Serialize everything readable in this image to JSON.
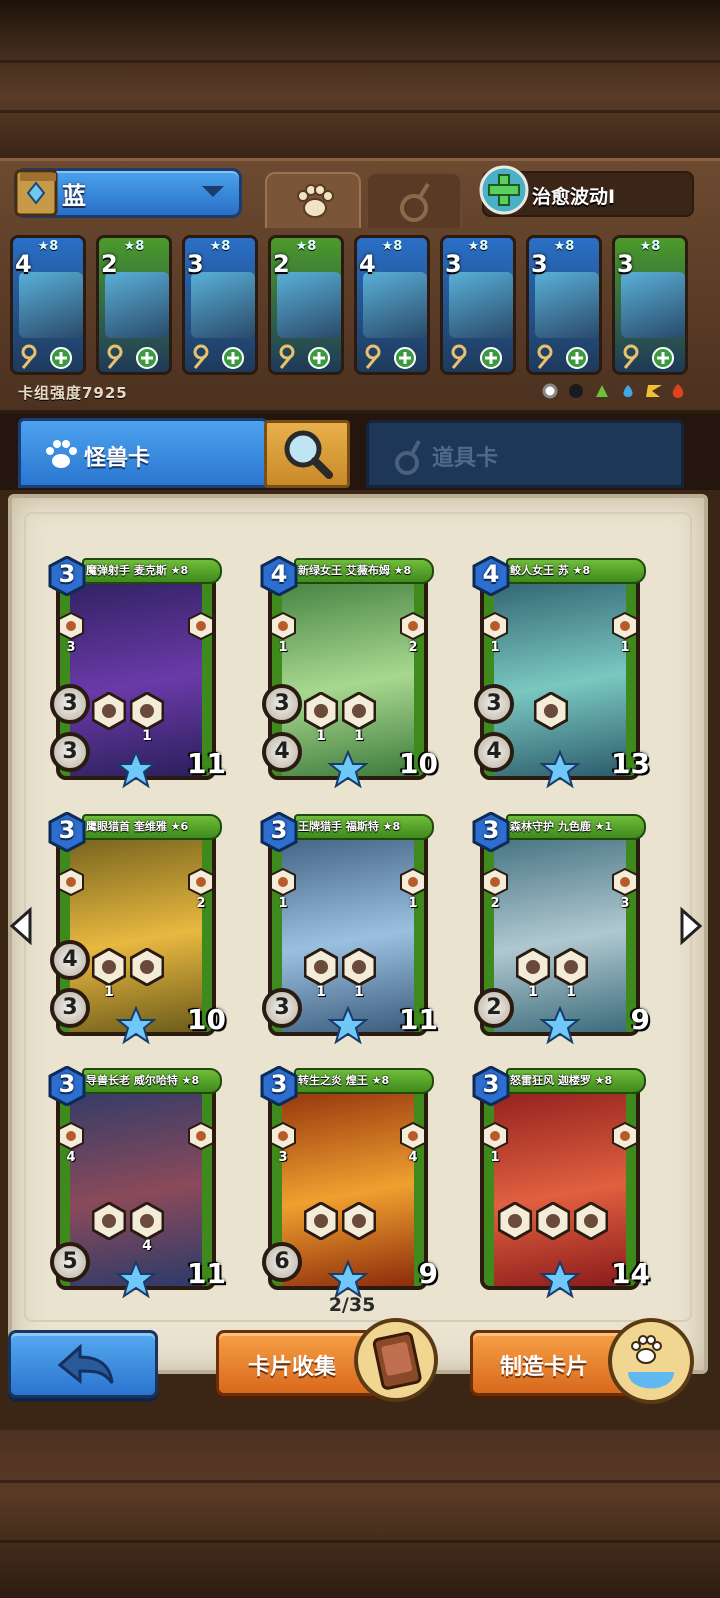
{
  "deck": {
    "name": "蓝",
    "strength_label": "卡组强度7925",
    "spell_name": "治愈波动I",
    "accent": "#3a8be0",
    "mini_cards": [
      {
        "stars": "★8",
        "cost": "4",
        "color": "#2a6fc6"
      },
      {
        "stars": "★8",
        "cost": "2",
        "color": "#4c9a2a"
      },
      {
        "stars": "★8",
        "cost": "3",
        "color": "#2a6fc6"
      },
      {
        "stars": "★8",
        "cost": "2",
        "color": "#4c9a2a"
      },
      {
        "stars": "★8",
        "cost": "4",
        "color": "#2a6fc6"
      },
      {
        "stars": "★8",
        "cost": "3",
        "color": "#2a6fc6"
      },
      {
        "stars": "★8",
        "cost": "3",
        "color": "#2a6fc6"
      },
      {
        "stars": "★8",
        "cost": "3",
        "color": "#4c9a2a"
      }
    ]
  },
  "tabs": {
    "monster_label": "怪兽卡",
    "item_label": "道具卡"
  },
  "cards": [
    {
      "title": "魔弹射手 麦克斯 ★8",
      "cost": "3",
      "attack": "3",
      "defense": "3",
      "hp": "11",
      "skills": [
        "",
        "1"
      ],
      "sides": [
        "3",
        ""
      ],
      "art": [
        "#2a1f5a",
        "#6a3aa8"
      ]
    },
    {
      "title": "新绿女王 艾薇布姆 ★8",
      "cost": "4",
      "attack": "3",
      "defense": "4",
      "hp": "10",
      "skills": [
        "1",
        "1"
      ],
      "sides": [
        "1",
        "2"
      ],
      "art": [
        "#3c7a3a",
        "#a8d890"
      ]
    },
    {
      "title": "鲛人女王 苏 ★8",
      "cost": "4",
      "attack": "3",
      "defense": "4",
      "hp": "13",
      "skills": [
        ""
      ],
      "sides": [
        "1",
        "1"
      ],
      "art": [
        "#2a5a6a",
        "#7ac8c0"
      ]
    },
    {
      "title": "鹰眼猎首 奎维雅 ★6",
      "cost": "3",
      "attack": "4",
      "defense": "3",
      "hp": "10",
      "skills": [
        "1",
        ""
      ],
      "sides": [
        "",
        "2"
      ],
      "art": [
        "#6a5a1a",
        "#e8b840"
      ]
    },
    {
      "title": "王牌猎手 福斯特 ★8",
      "cost": "3",
      "attack": "",
      "defense": "3",
      "hp": "11",
      "skills": [
        "1",
        "1"
      ],
      "sides": [
        "1",
        "1"
      ],
      "art": [
        "#3a5a7a",
        "#9ac0e0"
      ]
    },
    {
      "title": "森林守护 九色鹿 ★1",
      "cost": "3",
      "attack": "",
      "defense": "2",
      "hp": "9",
      "skills": [
        "1",
        "1"
      ],
      "sides": [
        "2",
        "3"
      ],
      "art": [
        "#3a6a7a",
        "#b0c8d0"
      ]
    },
    {
      "title": "导兽长老 威尔哈特 ★8",
      "cost": "3",
      "attack": "",
      "defense": "5",
      "hp": "11",
      "skills": [
        "",
        "4"
      ],
      "sides": [
        "4",
        ""
      ],
      "art": [
        "#2a3a6a",
        "#8a4a5a"
      ]
    },
    {
      "title": "转生之炎 煌王 ★8",
      "cost": "3",
      "attack": "",
      "defense": "6",
      "hp": "9",
      "skills": [
        "",
        ""
      ],
      "sides": [
        "3",
        "4"
      ],
      "art": [
        "#8a2a0a",
        "#f0a030"
      ]
    },
    {
      "title": "怒雷狂风 迦楼罗 ★8",
      "cost": "3",
      "attack": "",
      "defense": "",
      "hp": "14",
      "skills": [
        "",
        "",
        ""
      ],
      "sides": [
        "1",
        ""
      ],
      "art": [
        "#8a1a1a",
        "#e06040"
      ]
    }
  ],
  "pagination": {
    "text": "2/35"
  },
  "buttons": {
    "back_label": "",
    "collect_label": "卡片收集",
    "craft_label": "制造卡片"
  },
  "icons": {
    "deck": "book-icon",
    "dropdown": "chevron-down-icon",
    "monster_tab": "paw-icon",
    "item_tab": "flask-icon",
    "search": "magnifier-icon",
    "back": "back-arrow-icon",
    "prev": "chevron-left-icon",
    "next": "chevron-right-icon"
  }
}
